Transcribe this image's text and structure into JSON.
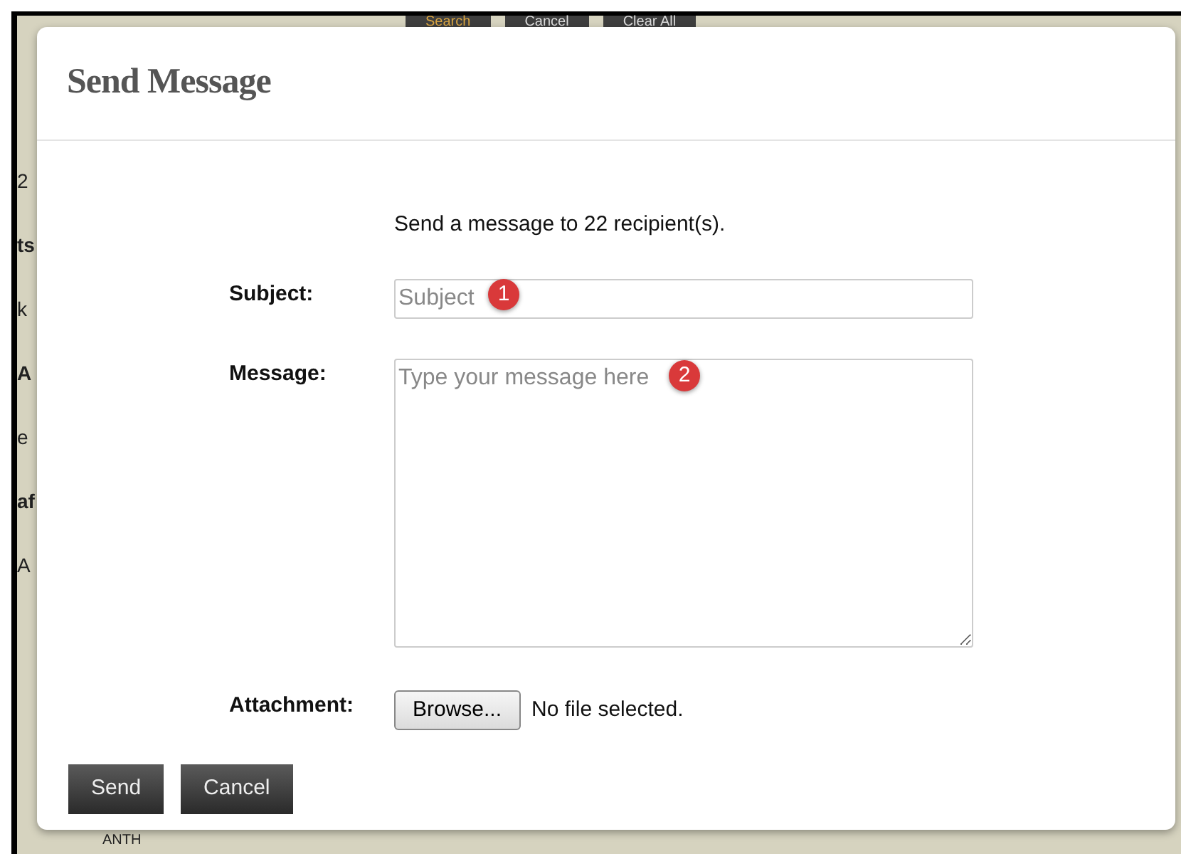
{
  "background_page": {
    "buttons": [
      {
        "label": "Search",
        "kind": "primary"
      },
      {
        "label": "Cancel",
        "kind": "plain"
      },
      {
        "label": "Clear All",
        "kind": "plain"
      }
    ],
    "fragments": [
      {
        "text": "2",
        "bold": false
      },
      {
        "text": "ts",
        "bold": true
      },
      {
        "text": "k",
        "bold": false
      },
      {
        "text": "A",
        "bold": true
      },
      {
        "text": "e",
        "bold": false
      },
      {
        "text": "af",
        "bold": true
      },
      {
        "text": "A",
        "bold": false
      }
    ],
    "footer_text": "ANTH"
  },
  "dialog": {
    "title": "Send Message",
    "intro": "Send a message to 22 recipient(s).",
    "fields": [
      {
        "label": "Subject:",
        "kind": "text",
        "placeholder": "Subject",
        "annotation": "1"
      },
      {
        "label": "Message:",
        "kind": "textarea",
        "placeholder": "Type your message here",
        "annotation": "2"
      },
      {
        "label": "Attachment:",
        "kind": "file",
        "button": "Browse...",
        "status": "No file selected."
      }
    ],
    "buttons": [
      "Send",
      "Cancel"
    ]
  }
}
